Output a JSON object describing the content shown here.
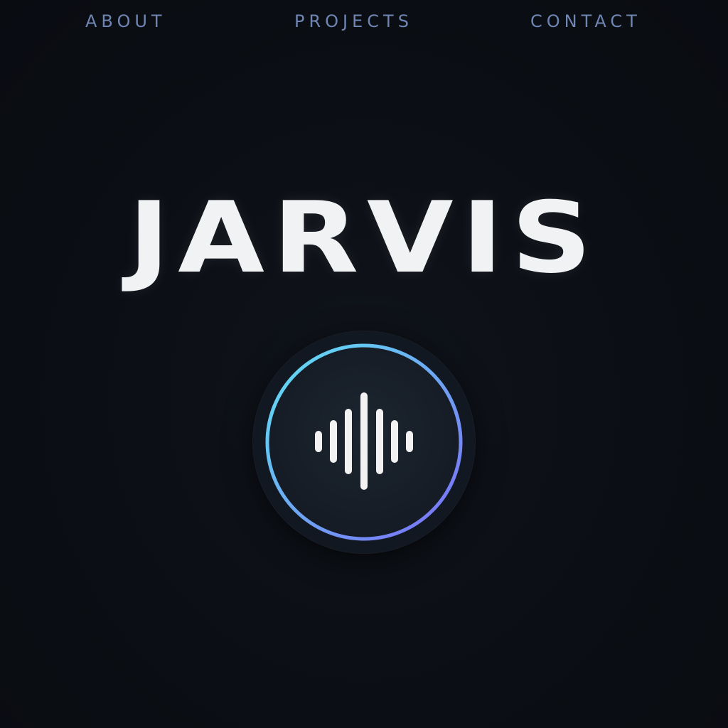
{
  "nav": {
    "items": [
      {
        "label": "ABOUT"
      },
      {
        "label": "PROJECTS"
      },
      {
        "label": "CONTACT"
      }
    ]
  },
  "hero": {
    "title": "JARVIS"
  },
  "voice_button": {
    "icon": "sound-wave-icon",
    "ring_gradient": [
      "#5fe3f2",
      "#7b6cf6"
    ],
    "background_color": "#121821"
  },
  "colors": {
    "background": "#0b0e14",
    "nav_text": "#6f86b4",
    "title_text": "#f1f2f3",
    "wave_bars": "#f2f2f2"
  }
}
